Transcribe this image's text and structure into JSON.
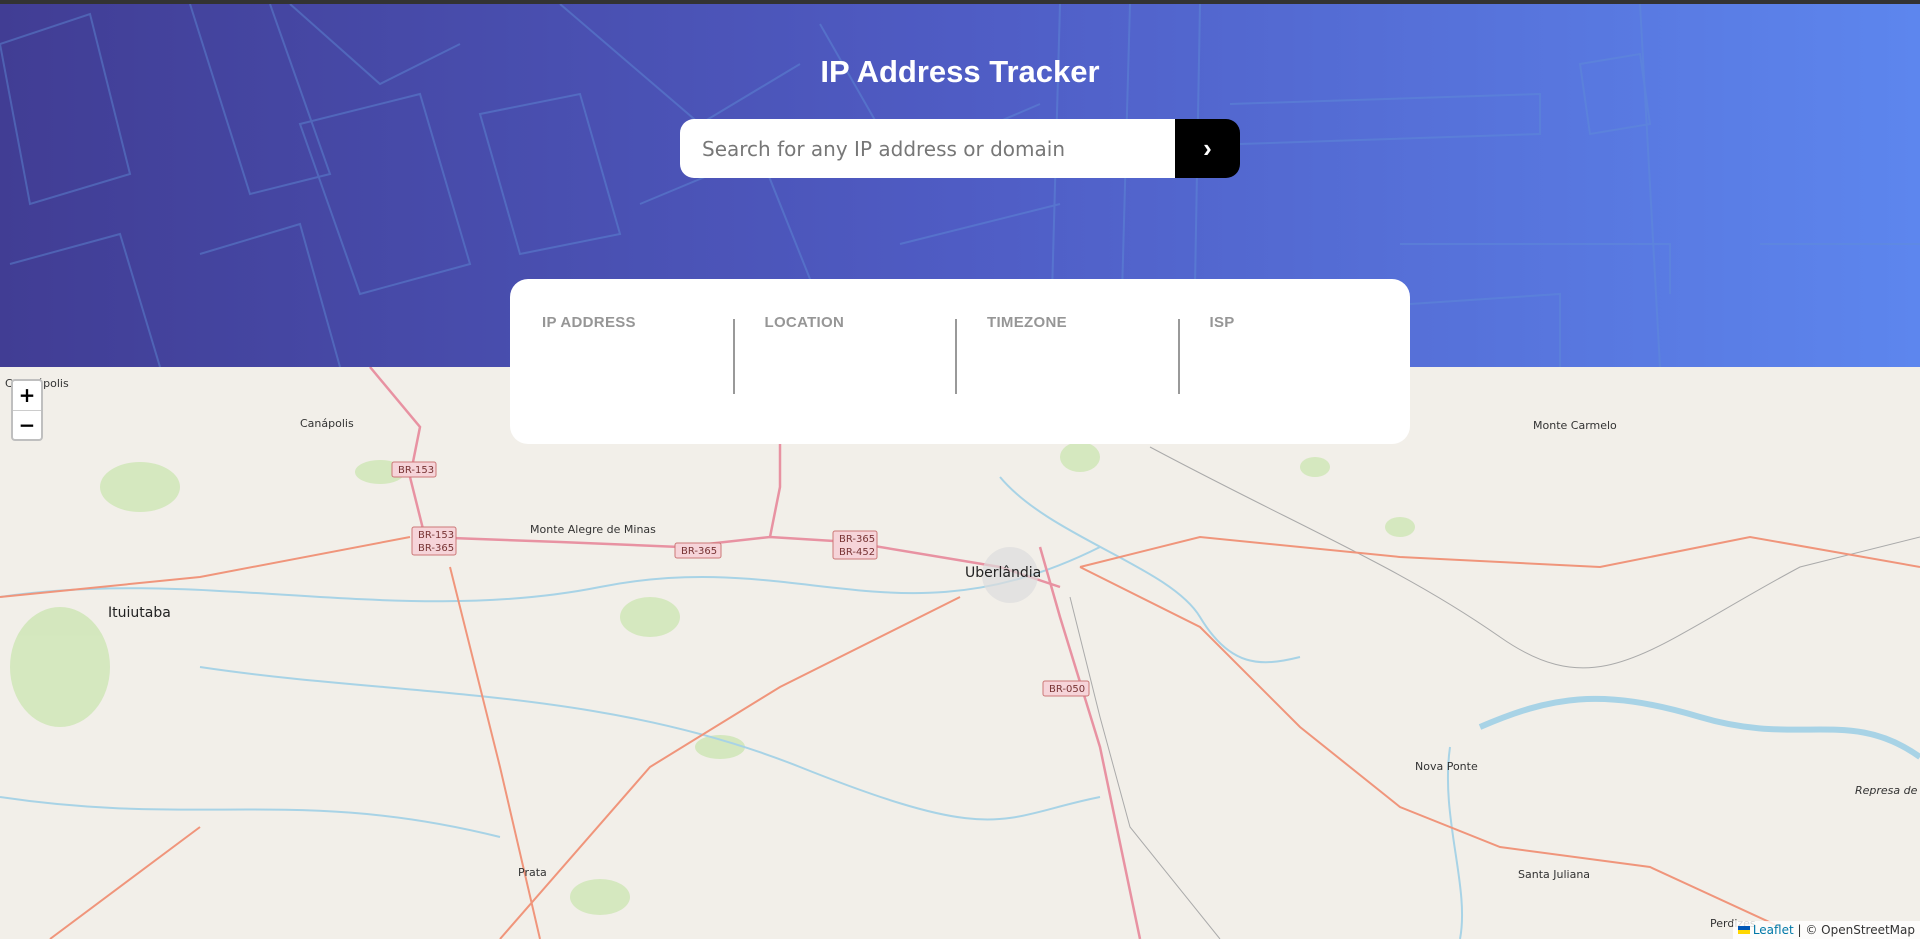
{
  "header": {
    "title": "IP Address Tracker"
  },
  "search": {
    "placeholder": "Search for any IP address or domain",
    "value": "",
    "submit_icon": "chevron-right-icon"
  },
  "info": [
    {
      "label": "IP ADDRESS",
      "value": ""
    },
    {
      "label": "LOCATION",
      "value": ""
    },
    {
      "label": "TIMEZONE",
      "value": ""
    },
    {
      "label": "ISP",
      "value": ""
    }
  ],
  "map": {
    "zoom_in": "+",
    "zoom_out": "−",
    "places": [
      "Capinópolis",
      "Canápolis",
      "Monte Alegre de Minas",
      "Ituiutaba",
      "Uberlândia",
      "Monte Carmelo",
      "Nova Ponte",
      "Santa Juliana",
      "Prata",
      "Perdizes",
      "Represa de Nova Ponte"
    ],
    "roads": [
      "BR-153",
      "BR-153",
      "BR-365",
      "BR-365",
      "BR-365",
      "BR-452",
      "BR-050"
    ],
    "attribution": {
      "leaflet": "Leaflet",
      "separator": " | ",
      "osm": "© OpenStreetMap"
    }
  }
}
